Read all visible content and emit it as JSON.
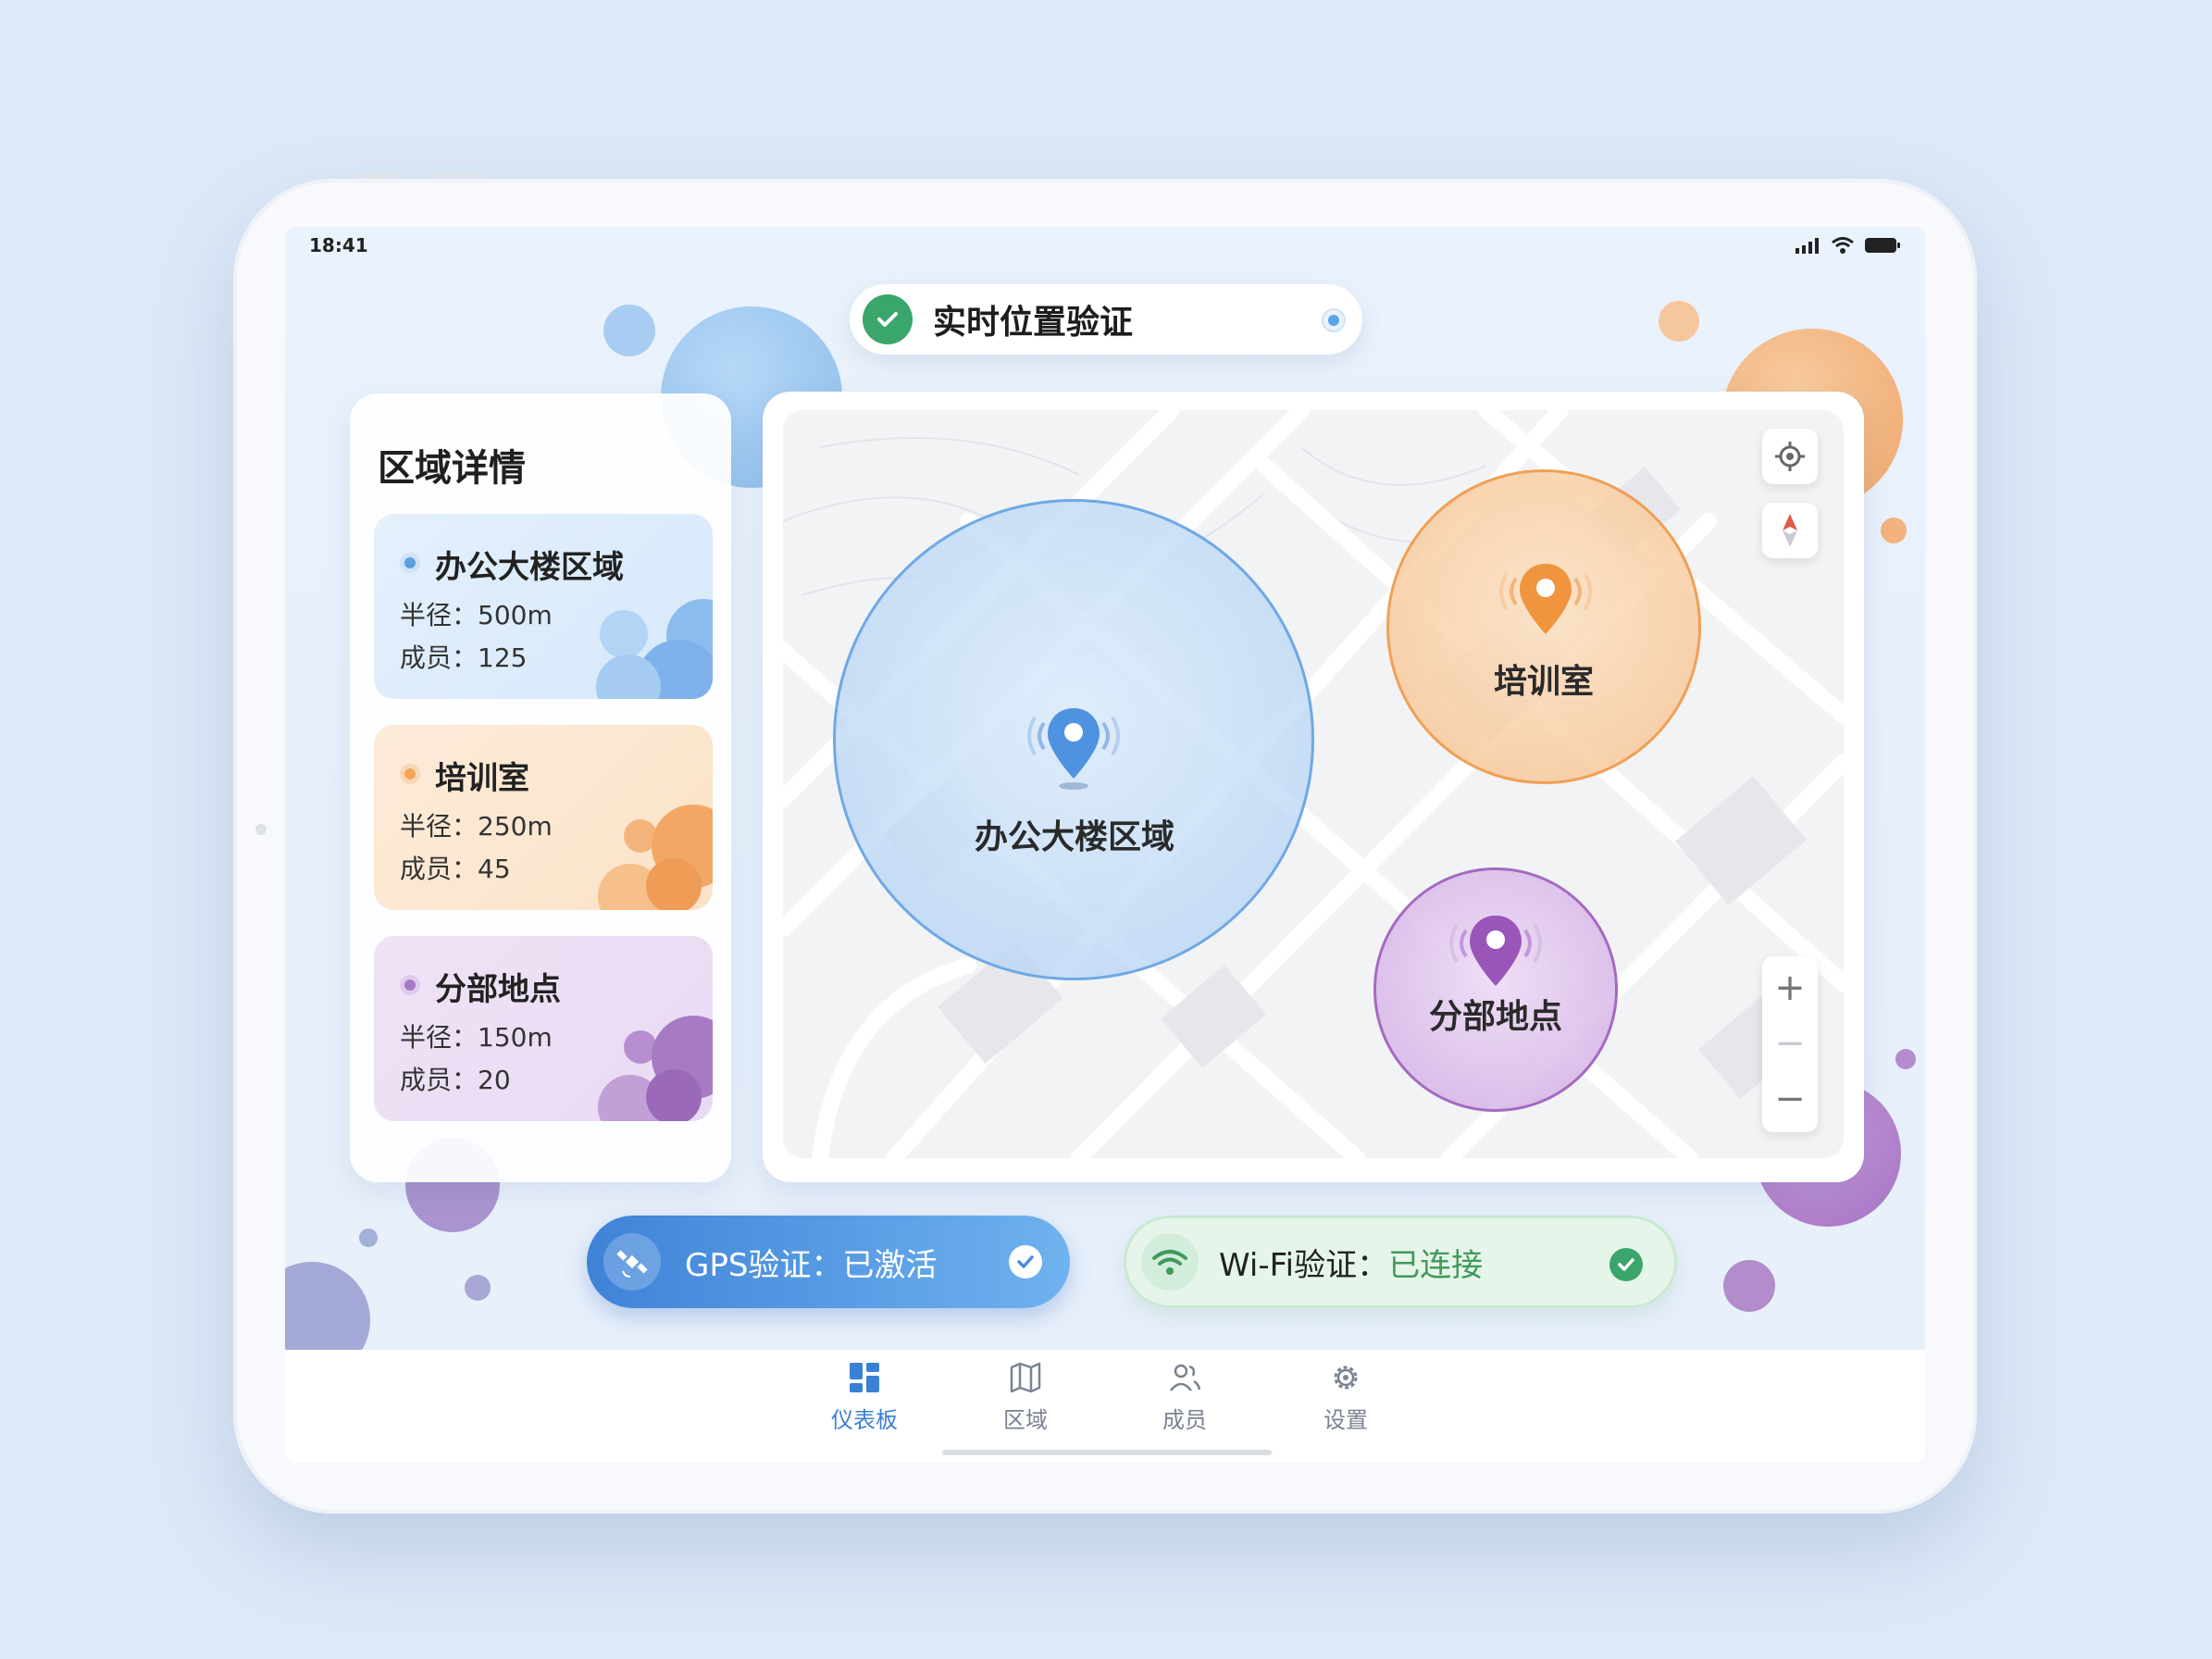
{
  "status_bar": {
    "time": "18:41"
  },
  "header": {
    "title": "实时位置验证"
  },
  "panel": {
    "title": "区域详情",
    "cards": [
      {
        "name": "办公大楼区域",
        "radius": "半径：500m",
        "members": "成员：125",
        "color": "#5b9fe0"
      },
      {
        "name": "培训室",
        "radius": "半径：250m",
        "members": "成员：45",
        "color": "#f2a45a"
      },
      {
        "name": "分部地点",
        "radius": "半径：150m",
        "members": "成员：20",
        "color": "#a77bc4"
      }
    ]
  },
  "map": {
    "zones": [
      {
        "label": "办公大楼区域",
        "color": "#6fa8e6"
      },
      {
        "label": "培训室",
        "color": "#f2a45a"
      },
      {
        "label": "分部地点",
        "color": "#a56ac0"
      }
    ],
    "controls": {
      "locate_icon": "crosshair-icon",
      "compass_icon": "compass-icon",
      "zoom_in": "+",
      "zoom_mid": "−",
      "zoom_out": "−"
    }
  },
  "verification": {
    "gps_label": "GPS验证：已激活",
    "wifi_label_prefix": "Wi-Fi验证：",
    "wifi_state": "已连接"
  },
  "tabs": [
    {
      "label": "仪表板",
      "icon": "dashboard-icon",
      "active": true
    },
    {
      "label": "区域",
      "icon": "map-icon",
      "active": false
    },
    {
      "label": "成员",
      "icon": "members-icon",
      "active": false
    },
    {
      "label": "设置",
      "icon": "settings-icon",
      "active": false
    }
  ],
  "colors": {
    "accent": "#3a80d4",
    "success": "#3aa66b"
  }
}
